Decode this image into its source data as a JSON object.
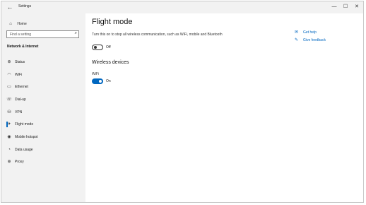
{
  "titlebar": {
    "back_glyph": "←",
    "title": "Settings",
    "min_glyph": "—",
    "max_glyph": "☐",
    "close_glyph": "✕"
  },
  "sidebar": {
    "home": {
      "label": "Home",
      "icon": "home-icon",
      "glyph": "⌂"
    },
    "search": {
      "placeholder": "Find a setting",
      "icon": "search-icon",
      "glyph": "⌕"
    },
    "section": "Network & Internet",
    "items": [
      {
        "label": "Status",
        "icon": "globe-icon",
        "glyph": "⊕",
        "active": false
      },
      {
        "label": "WiFi",
        "icon": "wifi-icon",
        "glyph": "◠",
        "active": false
      },
      {
        "label": "Ethernet",
        "icon": "ethernet-icon",
        "glyph": "▭",
        "active": false
      },
      {
        "label": "Dial-up",
        "icon": "phone-icon",
        "glyph": "☏",
        "active": false
      },
      {
        "label": "VPN",
        "icon": "vpn-icon",
        "glyph": "⛁",
        "active": false
      },
      {
        "label": "Flight mode",
        "icon": "airplane-icon",
        "glyph": "✈",
        "active": true
      },
      {
        "label": "Mobile hotspot",
        "icon": "hotspot-icon",
        "glyph": "◉",
        "active": false
      },
      {
        "label": "Data usage",
        "icon": "data-usage-icon",
        "glyph": "◔",
        "active": false
      },
      {
        "label": "Proxy",
        "icon": "globe-icon",
        "glyph": "⊕",
        "active": false
      }
    ]
  },
  "main": {
    "title": "Flight mode",
    "description": "Turn this on to stop all wireless communication, such as WiFi, mobile and Bluetooth",
    "flight_toggle": {
      "state": "Off",
      "on": false
    },
    "wireless_heading": "Wireless devices",
    "wifi_label": "WiFi",
    "wifi_toggle": {
      "state": "On",
      "on": true
    }
  },
  "help": {
    "get_help": {
      "label": "Get help",
      "icon": "help-chat-icon",
      "glyph": "✉"
    },
    "feedback": {
      "label": "Give feedback",
      "icon": "feedback-icon",
      "glyph": "✎"
    }
  },
  "colors": {
    "accent": "#0067c0",
    "sidebar_bg": "#f2f2f2"
  }
}
